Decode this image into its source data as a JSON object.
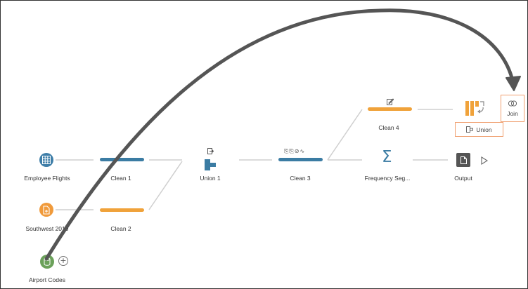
{
  "flow": {
    "inputs": {
      "employee_flights": "Employee Flights",
      "southwest_2019": "Southwest 2019",
      "airport_codes": "Airport Codes"
    },
    "steps": {
      "clean_1": "Clean 1",
      "clean_2": "Clean 2",
      "union_1": "Union 1",
      "clean_3": "Clean 3",
      "clean_4": "Clean 4",
      "frequency": "Frequency Seg...",
      "output": "Output"
    },
    "drag_targets": {
      "join": "Join",
      "union": "Union"
    }
  },
  "colors": {
    "input_blue": "#3e7ea8",
    "input_orange": "#f09a3b",
    "input_green": "#6ba15a",
    "step_blue": "#3b7ca3",
    "step_orange": "#f0a23a",
    "target_border": "#f0a070",
    "arrow": "#555555"
  },
  "icons": [
    "table-icon",
    "file-plus-icon",
    "database-icon",
    "union-icon",
    "sigma-icon",
    "output-file-icon",
    "play-icon",
    "pencil-icon",
    "join-icon"
  ]
}
